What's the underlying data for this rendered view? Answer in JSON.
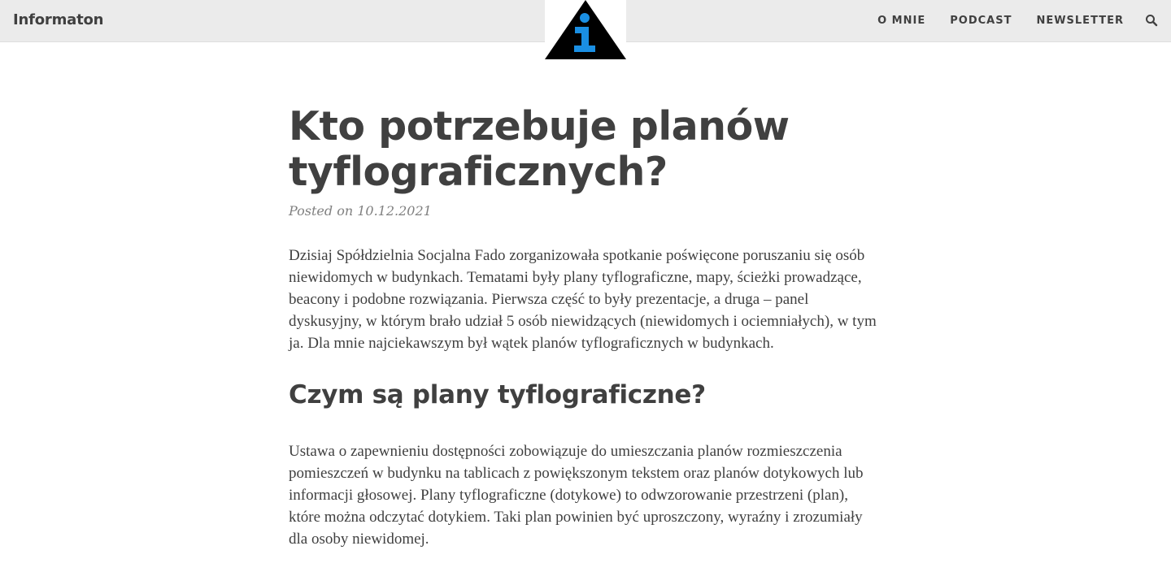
{
  "header": {
    "brand": "Informaton",
    "nav": [
      "O MNIE",
      "PODCAST",
      "NEWSLETTER"
    ],
    "search_icon": "search-icon",
    "logo_icon": "info-triangle-logo-icon"
  },
  "post": {
    "title": "Kto potrzebuje planów tyflograficznych?",
    "meta": "Posted on 10.12.2021",
    "paragraph1": "Dzisiaj Spółdzielnia Socjalna Fado zorganizowała spotkanie poświęcone poruszaniu się osób niewidomych w budynkach. Tematami były plany tyflograficzne, mapy, ścieżki prowadzące, beacony i podobne rozwiązania. Pierwsza część to były prezentacje, a druga – panel dyskusyjny, w którym brało udział 5 osób niewidzących (niewidomych i ociemniałych), w tym ja. Dla mnie najciekawszym był wątek planów tyflograficznych w budynkach.",
    "heading2": "Czym są plany tyflograficzne?",
    "paragraph2": "Ustawa o zapewnieniu dostępności zobowiązuje do umieszczania planów rozmieszczenia pomieszczeń w budynku na tablicach z powiększonym tekstem oraz planów dotykowych lub informacji głosowej. Plany tyflograficzne (dotykowe) to odwzorowanie przestrzeni (plan), które można odczytać dotykiem. Taki plan powinien być uproszczony, wyraźny i zrozumiały dla osoby niewidomej."
  },
  "colors": {
    "header_bg": "#ebebeb",
    "text": "#404040",
    "logo_accent": "#1a8fe3"
  }
}
